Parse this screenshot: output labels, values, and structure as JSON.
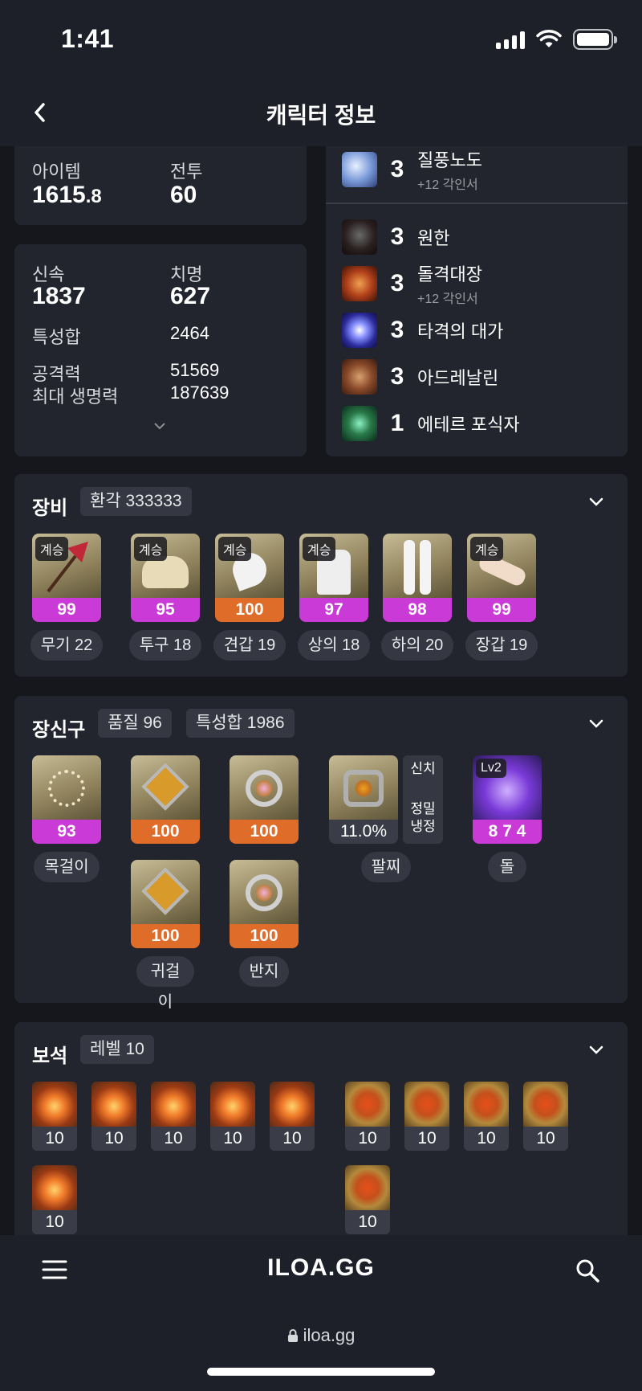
{
  "status": {
    "time": "1:41"
  },
  "header": {
    "title": "캐릭터 정보"
  },
  "levels": {
    "item_label": "아이템",
    "item_value_int": "1615",
    "item_value_dec": ".8",
    "combat_label": "전투",
    "combat_value": "60"
  },
  "stats": {
    "swift_label": "신속",
    "swift_value": "1837",
    "crit_label": "치명",
    "crit_value": "627",
    "sum_label": "특성합",
    "sum_value": "2464",
    "atk_label": "공격력",
    "atk_value": "51569",
    "hp_label": "최대 생명력",
    "hp_value": "187639"
  },
  "engravings": [
    {
      "level": "3",
      "name": "질풍노도",
      "sub": "+12 각인서",
      "icon": "gale-icon"
    },
    {
      "level": "3",
      "name": "원한",
      "sub": "",
      "icon": "grudge-icon"
    },
    {
      "level": "3",
      "name": "돌격대장",
      "sub": "+12 각인서",
      "icon": "raid-captain-icon"
    },
    {
      "level": "3",
      "name": "타격의 대가",
      "sub": "",
      "icon": "hit-master-icon"
    },
    {
      "level": "3",
      "name": "아드레날린",
      "sub": "",
      "icon": "adrenaline-icon"
    },
    {
      "level": "1",
      "name": "에테르 포식자",
      "sub": "",
      "icon": "ether-predator-icon"
    }
  ],
  "equipment": {
    "title": "장비",
    "tag": "환각 333333",
    "items": [
      {
        "badge": "계승",
        "quality": "99",
        "label": "무기 22",
        "color": "#c93ad6"
      },
      {
        "badge": "계승",
        "quality": "95",
        "label": "투구 18",
        "color": "#c93ad6"
      },
      {
        "badge": "계승",
        "quality": "100",
        "label": "견갑 19",
        "color": "#e06c2a"
      },
      {
        "badge": "계승",
        "quality": "97",
        "label": "상의 18",
        "color": "#c93ad6"
      },
      {
        "badge": "",
        "quality": "98",
        "label": "하의 20",
        "color": "#c93ad6"
      },
      {
        "badge": "계승",
        "quality": "99",
        "label": "장갑 19",
        "color": "#c93ad6"
      }
    ]
  },
  "accessories": {
    "title": "장신구",
    "tag_quality": "품질 96",
    "tag_stat": "특성합 1986",
    "necklace": {
      "quality": "93",
      "label": "목걸이"
    },
    "earring1": {
      "quality": "100"
    },
    "earring2": {
      "quality": "100"
    },
    "earring_label": "귀걸이",
    "ring1": {
      "quality": "100"
    },
    "ring2": {
      "quality": "100"
    },
    "ring_label": "반지",
    "bracelet": {
      "value": "11.0%",
      "label": "팔찌",
      "effect1": "신치",
      "effect2": "정밀",
      "effect3": "냉정"
    },
    "stone": {
      "badge": "Lv2",
      "value": "8 7 4",
      "label": "돌"
    }
  },
  "gems": {
    "title": "보석",
    "tag": "레벨 10",
    "left": [
      "10",
      "10",
      "10",
      "10",
      "10",
      "10"
    ],
    "right": [
      "10",
      "10",
      "10",
      "10",
      "10"
    ]
  },
  "bottom": {
    "logo": "ILOA.GG",
    "url": "iloa.gg"
  }
}
